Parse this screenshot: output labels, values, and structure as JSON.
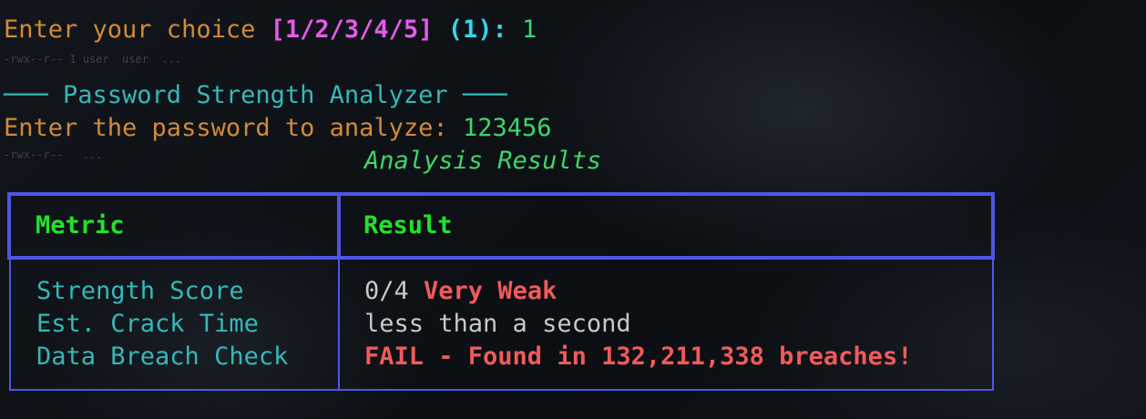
{
  "prompt": {
    "label": "Enter your choice",
    "options": "[1/2/3/4/5]",
    "default": "(1)",
    "separator": ":",
    "input": "1"
  },
  "ghost_line_1": "-rwx--r-- 1 user  user  ...",
  "section_title": "─── Password Strength Analyzer ───",
  "password_prompt": {
    "label": "Enter the password to analyze:",
    "input": "123456"
  },
  "ghost_line_2": "-rwx--r--   ...",
  "results_title": "Analysis Results",
  "table": {
    "headers": [
      "Metric",
      "Result"
    ],
    "rows": [
      {
        "metric": "Strength Score",
        "result_prefix": "0/4 ",
        "result_highlight": "Very Weak"
      },
      {
        "metric": "Est. Crack Time",
        "result_prefix": "less than a second",
        "result_highlight": ""
      },
      {
        "metric": "Data Breach Check",
        "result_prefix": "",
        "result_highlight": "FAIL - Found in 132,211,338 breaches!"
      }
    ]
  },
  "colors": {
    "prompt": "#d08a3a",
    "options": "#e15ce8",
    "default": "#38d4e8",
    "input": "#3dd66a",
    "border": "#5055e6",
    "header": "#22e12c",
    "fail": "#f05a5a"
  }
}
